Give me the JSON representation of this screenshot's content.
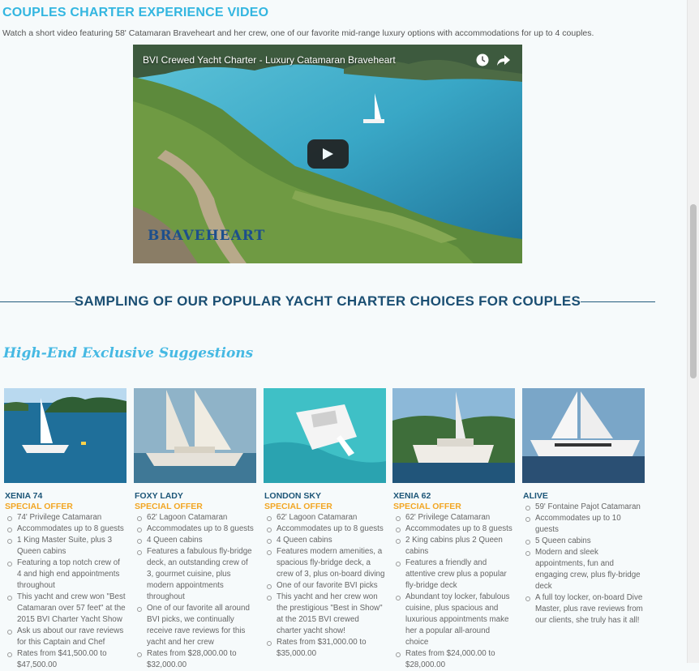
{
  "video_section": {
    "title": "COUPLES CHARTER EXPERIENCE VIDEO",
    "intro": "Watch a short video featuring 58' Catamaran Braveheart and her crew, one of our favorite mid-range luxury options with accommodations for up to 4 couples.",
    "video_title": "BVI Crewed Yacht Charter - Luxury Catamaran Braveheart",
    "logo_text": "BRAVEHEART",
    "icons": [
      "clock-icon",
      "share-icon",
      "play-icon"
    ]
  },
  "sampling": {
    "title": "SAMPLING OF OUR POPULAR YACHT CHARTER CHOICES FOR COUPLES",
    "subheading": "High-End Exclusive Suggestions"
  },
  "colors": {
    "accent_blue": "#33b6e0",
    "navy": "#1b4f73",
    "offer_orange": "#f2a623"
  },
  "yachts": [
    {
      "name": "XENIA 74",
      "offer": "SPECIAL OFFER",
      "features": [
        "74' Privilege Catamaran",
        "Accommodates up to 8 guests",
        "1 King Master Suite, plus 3 Queen cabins",
        "Featuring a top notch crew of 4 and high end appointments throughout",
        "This yacht and crew won \"Best Catamaran over 57 feet\" at the 2015 BVI Charter Yacht Show",
        "Ask us about our rave reviews for this Captain and Chef",
        "Rates from $41,500.00 to $47,500.00"
      ]
    },
    {
      "name": "FOXY LADY",
      "offer": "SPECIAL OFFER",
      "features": [
        "62' Lagoon Catamaran",
        "Accommodates up to 8 guests",
        "4 Queen cabins",
        "Features a fabulous fly-bridge deck, an outstanding crew of 3, gourmet cuisine, plus modern appointments throughout",
        "One of our favorite all around BVI picks, we continually receive rave reviews for this yacht and her crew",
        "Rates from $28,000.00 to $32,000.00"
      ]
    },
    {
      "name": "LONDON SKY",
      "offer": "SPECIAL OFFER",
      "features": [
        "62' Lagoon Catamaran",
        "Accommodates up to 8 guests",
        "4 Queen cabins",
        "Features modern amenities, a spacious fly-bridge deck, a crew of 3, plus on-board diving",
        "One of our favorite BVI picks",
        "This yacht and her crew won the prestigious \"Best in Show\" at the 2015 BVI crewed charter yacht show!",
        "Rates from $31,000.00 to $35,000.00"
      ]
    },
    {
      "name": "XENIA 62",
      "offer": "SPECIAL OFFER",
      "features": [
        "62' Privilege Catamaran",
        "Accommodates up to 8 guests",
        "2 King cabins plus 2 Queen cabins",
        "Features a friendly and attentive crew plus a popular fly-bridge deck",
        "Abundant toy locker, fabulous cuisine, plus spacious and luxurious appointments make her a popular all-around choice",
        "Rates from $24,000.00 to $28,000.00"
      ]
    },
    {
      "name": "ALIVE",
      "offer": "",
      "features": [
        "59' Fontaine Pajot Catamaran",
        "Accommodates up to 10 guests",
        "5 Queen cabins",
        "Modern and sleek appointments, fun and engaging crew, plus fly-bridge deck",
        "A full toy locker, on-board Dive Master, plus rave reviews from our clients, she truly has it all!"
      ]
    }
  ]
}
